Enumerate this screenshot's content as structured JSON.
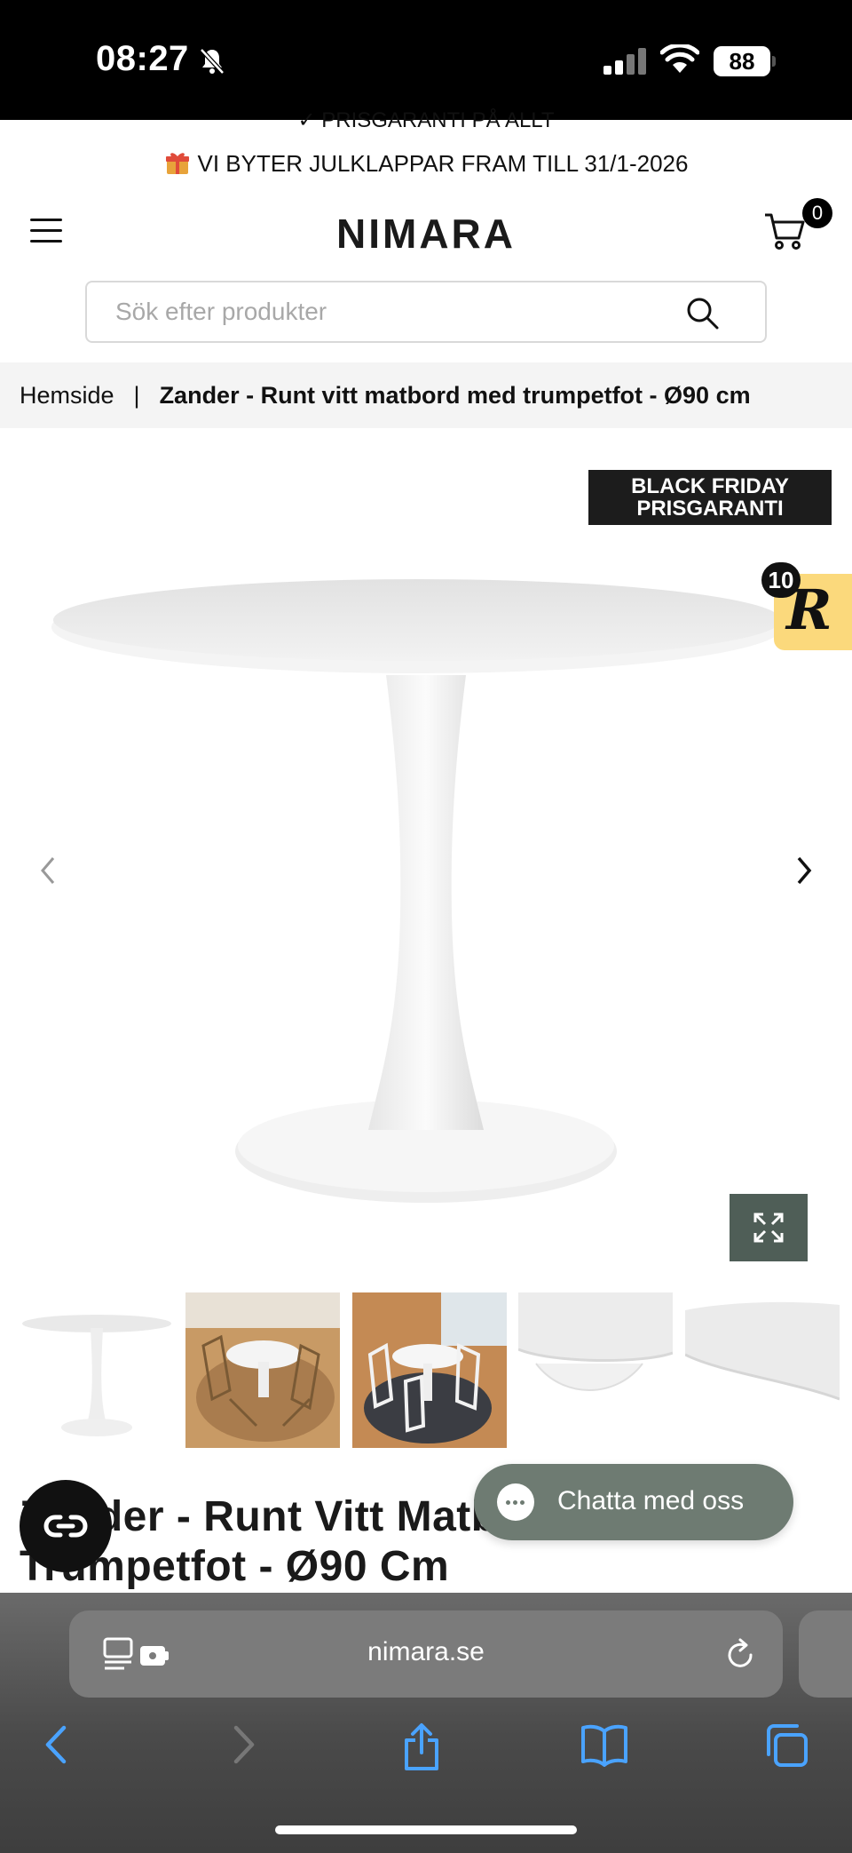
{
  "status_bar": {
    "time": "08:27",
    "battery": "88",
    "icons": [
      "bell-slash-icon",
      "signal-icon",
      "wifi-icon",
      "battery-icon"
    ]
  },
  "announcement": {
    "previous": "✓ PRISGARANTI PÅ ALLT",
    "current": "VI BYTER JULKLAPPAR FRAM TILL 31/1-2026",
    "icon": "gift-icon"
  },
  "header": {
    "logo": "NIMARA",
    "cart_count": "0",
    "menu_icon": "hamburger-icon",
    "cart_icon": "cart-icon"
  },
  "search": {
    "placeholder": "Sök efter produkter",
    "value": "",
    "icon": "search-icon"
  },
  "breadcrumb": {
    "home": "Hemside",
    "separator": "|",
    "current": "Zander - Runt vitt matbord med trumpetfot - Ø90 cm"
  },
  "gallery": {
    "badge_line1": "BLACK FRIDAY",
    "badge_line2": "PRISGARANTI",
    "thumbnail_count": 5
  },
  "rewards": {
    "count": "10",
    "letter": "R"
  },
  "product": {
    "title": "Zander - Runt Vitt Matbord Med Trumpetfot - Ø90 Cm"
  },
  "chat": {
    "label": "Chatta med oss"
  },
  "browser": {
    "url": "nimara.se"
  },
  "colors": {
    "brand_dark": "#1c1c1c",
    "chat_green": "#6e7b72",
    "expand_green": "#4f5e57",
    "reward_yellow": "#fbd97c"
  }
}
